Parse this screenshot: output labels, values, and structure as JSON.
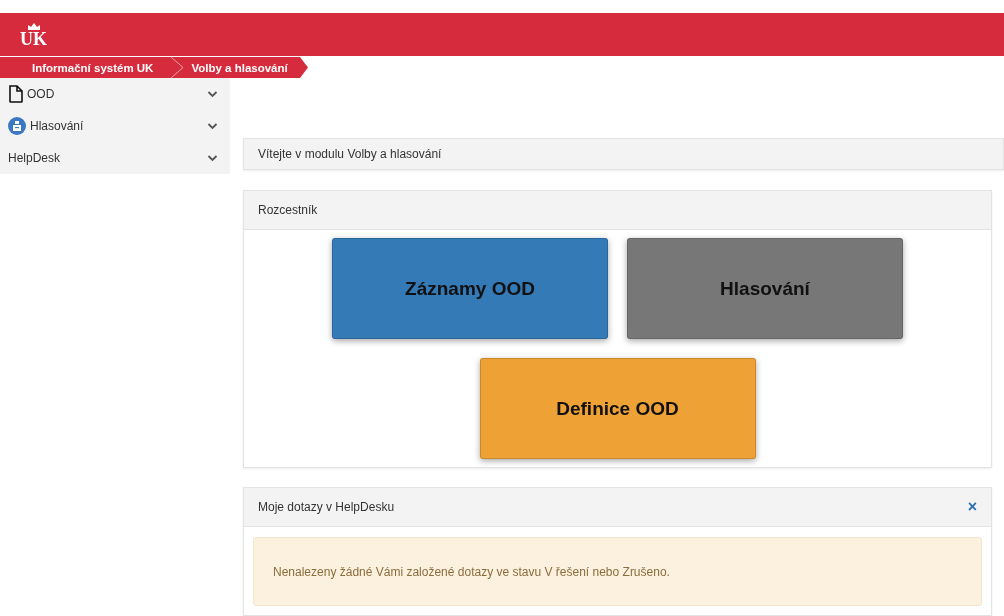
{
  "header": {
    "logo": "UK"
  },
  "breadcrumb": [
    {
      "label": "Informační systém UK"
    },
    {
      "label": "Volby a hlasování"
    }
  ],
  "sidebar": {
    "items": [
      {
        "label": "OOD",
        "kind": "document",
        "expanded": false
      },
      {
        "label": "Hlasování",
        "kind": "ballot",
        "expanded": false
      },
      {
        "label": "HelpDesk",
        "kind": "none",
        "expanded": false
      }
    ]
  },
  "welcome": {
    "title": "Vítejte v modulu Volby a hlasování"
  },
  "signpost": {
    "title": "Rozcestník",
    "tiles": [
      {
        "label": "Záznamy OOD",
        "color": "#337ab7"
      },
      {
        "label": "Hlasování",
        "color": "#777777"
      },
      {
        "label": "Definice OOD",
        "color": "#eea236"
      }
    ]
  },
  "helpdesk": {
    "title": "Moje dotazy v HelpDesku",
    "close": "×",
    "alert": "Nenalezeny žádné Vámi založené dotazy ve stavu V řešení nebo Zrušeno."
  }
}
